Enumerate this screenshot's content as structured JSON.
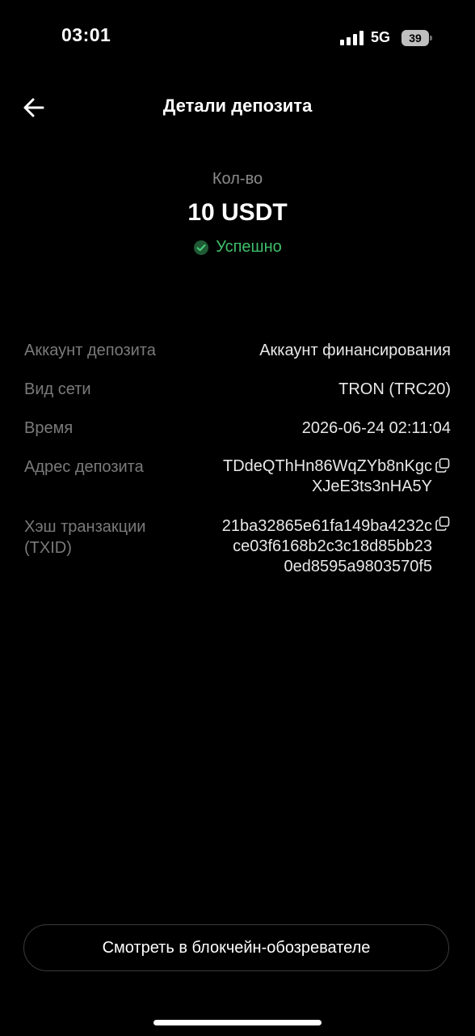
{
  "status_bar": {
    "time": "03:01",
    "network": "5G",
    "battery": "39"
  },
  "header": {
    "title": "Детали депозита",
    "back_icon": "arrow-left-icon"
  },
  "summary": {
    "quantity_label": "Кол-во",
    "amount": "10 USDT",
    "status": "Успешно",
    "status_color": "#3fbf6a"
  },
  "details": {
    "account_label": "Аккаунт депозита",
    "account_value": "Аккаунт финансирования",
    "network_label": "Вид сети",
    "network_value": "TRON (TRC20)",
    "time_label": "Время",
    "time_value": "2026-06-24 02:11:04",
    "address_label": "Адрес депозита",
    "address_line1": "TDdeQThHn86WqZYb8nKgc",
    "address_line2": "XJeE3ts3nHA5Y",
    "txid_label_line1": "Хэш транзакции",
    "txid_label_line2": "(TXID)",
    "txid_line1": "21ba32865e61fa149ba4232c",
    "txid_line2": "ce03f6168b2c3c18d85bb23",
    "txid_line3": "0ed8595a9803570f5"
  },
  "footer": {
    "explorer_button": "Смотреть в блокчейн-обозревателе"
  }
}
